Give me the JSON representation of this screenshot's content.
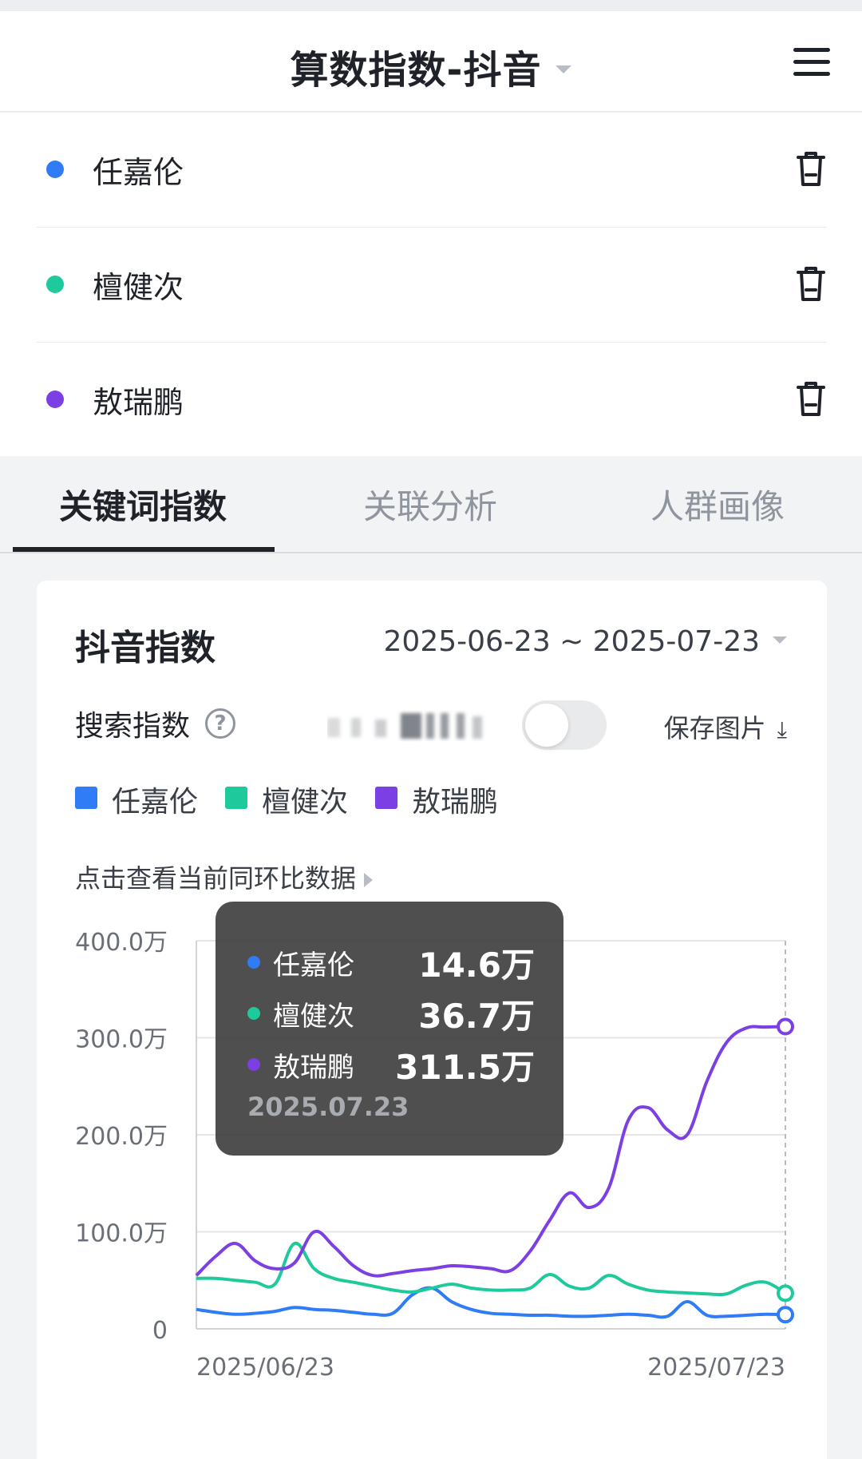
{
  "header": {
    "title": "算数指数-抖音"
  },
  "keywords": [
    {
      "name": "任嘉伦",
      "color": "#2f7cf6"
    },
    {
      "name": "檀健次",
      "color": "#1ec99b"
    },
    {
      "name": "敖瑞鹏",
      "color": "#7b3fe4"
    }
  ],
  "tabs": [
    {
      "label": "关键词指数",
      "active": true
    },
    {
      "label": "关联分析",
      "active": false
    },
    {
      "label": "人群画像",
      "active": false
    }
  ],
  "card": {
    "title": "抖音指数",
    "date_range": "2025-06-23 ~ 2025-07-23",
    "metric_label": "搜索指数",
    "help_icon": "?",
    "save_label": "保存图片",
    "compare_link": "点击查看当前同环比数据"
  },
  "tooltip": {
    "date": "2025.07.23",
    "rows": [
      {
        "name": "任嘉伦",
        "value": "14.6万",
        "color": "#2f7cf6"
      },
      {
        "name": "檀健次",
        "value": "36.7万",
        "color": "#1ec99b"
      },
      {
        "name": "敖瑞鹏",
        "value": "311.5万",
        "color": "#7b3fe4"
      }
    ]
  },
  "chart_data": {
    "type": "line",
    "y_ticks": [
      "400.0万",
      "300.0万",
      "200.0万",
      "100.0万",
      "0"
    ],
    "ylim": [
      0,
      400
    ],
    "x_tick_labels": [
      "2025/06/23",
      "2025/07/23"
    ],
    "x": [
      "06/23",
      "06/24",
      "06/25",
      "06/26",
      "06/27",
      "06/28",
      "06/29",
      "06/30",
      "07/01",
      "07/02",
      "07/03",
      "07/04",
      "07/05",
      "07/06",
      "07/07",
      "07/08",
      "07/09",
      "07/10",
      "07/11",
      "07/12",
      "07/13",
      "07/14",
      "07/15",
      "07/16",
      "07/17",
      "07/18",
      "07/19",
      "07/20",
      "07/21",
      "07/22",
      "07/23"
    ],
    "series": [
      {
        "name": "任嘉伦",
        "color": "#2f7cf6",
        "values": [
          20,
          17,
          15,
          16,
          18,
          22,
          20,
          19,
          17,
          15,
          16,
          35,
          42,
          28,
          20,
          16,
          15,
          14,
          14,
          13,
          13,
          14,
          15,
          14,
          13,
          28,
          14,
          13,
          14,
          15,
          14.6
        ]
      },
      {
        "name": "檀健次",
        "color": "#1ec99b",
        "values": [
          52,
          52,
          50,
          48,
          46,
          88,
          62,
          52,
          48,
          44,
          40,
          38,
          42,
          46,
          42,
          40,
          40,
          42,
          56,
          44,
          42,
          55,
          46,
          40,
          38,
          37,
          36,
          36,
          45,
          48,
          36.7
        ]
      },
      {
        "name": "敖瑞鹏",
        "color": "#7b3fe4",
        "values": [
          55,
          75,
          88,
          70,
          62,
          68,
          100,
          85,
          65,
          55,
          57,
          60,
          62,
          65,
          64,
          62,
          60,
          80,
          112,
          140,
          125,
          145,
          215,
          228,
          205,
          200,
          255,
          295,
          310,
          311,
          311.5
        ]
      }
    ],
    "grid": true
  }
}
